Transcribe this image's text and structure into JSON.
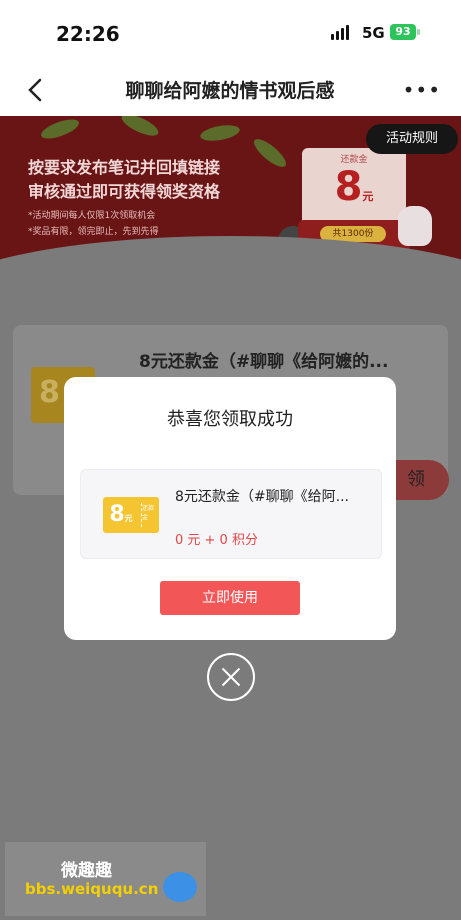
{
  "status_bar": {
    "time": "22:26",
    "network": "5G",
    "battery": "93"
  },
  "nav": {
    "back_icon": "chevron-left-icon",
    "title": "聊聊给阿嬷的情书观后感",
    "more_icon": "more-horizontal-icon",
    "more_label": "•••"
  },
  "banner": {
    "line1": "按要求发布笔记并回填链接",
    "line2": "审核通过即可获得领奖资格",
    "note1": "*活动期间每人仅限1次领取机会",
    "note2": "*奖品有限，领完即止，先到先得",
    "rules_button": "活动规则",
    "cash_label": "还款金",
    "cash_amount": "8",
    "cash_unit": "元",
    "cash_count": "共1300份"
  },
  "background_coupon": {
    "title": "8元还款金（#聊聊《给阿嬷的...",
    "ticket_text": "8",
    "claim_text": "领"
  },
  "modal": {
    "title": "恭喜您领取成功",
    "coupon": {
      "ticket_value": "8",
      "ticket_unit": "元",
      "ticket_side": "还款金",
      "name": "8元还款金（#聊聊《给阿...",
      "price": "0 元 + 0 积分"
    },
    "use_button": "立即使用",
    "close_icon": "close-circle-icon"
  },
  "watermark": {
    "name": "微趣趣",
    "url": "bbs.weiququ.cn"
  }
}
